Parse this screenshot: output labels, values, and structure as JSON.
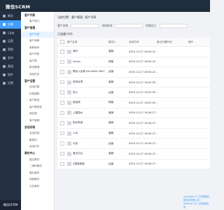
{
  "app": {
    "title": "微信SCRM",
    "bottom_label": "微信SCRM"
  },
  "left_nav": [
    {
      "label": "概况",
      "icon": "home-icon",
      "active": false
    },
    {
      "label": "企微",
      "icon": "wechat-icon",
      "active": true
    },
    {
      "label": "CRM",
      "icon": "crm-icon",
      "active": false
    },
    {
      "label": "运营",
      "icon": "chart-icon",
      "active": false
    },
    {
      "label": "营销",
      "icon": "megaphone-icon",
      "active": false
    },
    {
      "label": "发布",
      "icon": "send-icon",
      "active": false
    },
    {
      "label": "渠道",
      "icon": "channel-icon",
      "active": false
    },
    {
      "label": "插件",
      "icon": "plugin-icon",
      "active": false
    },
    {
      "label": "设置",
      "icon": "gear-icon",
      "active": false
    }
  ],
  "sub_nav": [
    {
      "type": "group",
      "label": "客户列表"
    },
    {
      "type": "item",
      "label": "客户统计"
    },
    {
      "type": "group",
      "label": "客户管理"
    },
    {
      "type": "item",
      "label": "客户列表",
      "active": true
    },
    {
      "type": "item",
      "label": "客户转移"
    },
    {
      "type": "item",
      "label": "离职继承"
    },
    {
      "type": "item",
      "label": "客户标签"
    },
    {
      "type": "item",
      "label": "客户群"
    },
    {
      "type": "item",
      "label": "群发管理"
    },
    {
      "type": "item",
      "label": "添加任务"
    },
    {
      "type": "group",
      "label": "客户运营"
    },
    {
      "type": "item",
      "label": "自动拉群"
    },
    {
      "type": "item",
      "label": "标签建群"
    },
    {
      "type": "item",
      "label": "客户群发"
    },
    {
      "type": "item",
      "label": "客户群群发"
    },
    {
      "type": "item",
      "label": "朋友圈"
    },
    {
      "type": "item",
      "label": "客户营销"
    },
    {
      "type": "group",
      "label": "会话存档"
    },
    {
      "type": "item",
      "label": "会话存档"
    },
    {
      "type": "item",
      "label": "敏感词"
    },
    {
      "type": "item",
      "label": "会话分析"
    },
    {
      "type": "group",
      "label": "素材中心"
    },
    {
      "type": "item",
      "label": "图文素材"
    },
    {
      "type": "item",
      "label": "二维码素材"
    },
    {
      "type": "item",
      "label": "图片素材"
    },
    {
      "type": "item",
      "label": "视频素材"
    },
    {
      "type": "item",
      "label": "文件素材"
    }
  ],
  "breadcrumb": {
    "prefix": "当前位置：",
    "parts": [
      "客户管理",
      "客户列表"
    ]
  },
  "filters": [
    {
      "label": "客户名称",
      "placeholder": ""
    },
    {
      "label": "添加时间",
      "placeholder": ""
    },
    {
      "label": "所属员工",
      "placeholder": ""
    }
  ],
  "section_title": "已选客户(0)",
  "table": {
    "headers": [
      "客户名称",
      "跟进人",
      "添加时间",
      "最近沟通时间",
      "操作"
    ],
    "rows": [
      {
        "name": "海尔",
        "agent": "客服",
        "date": "2019-12-27 16:53:41",
        "last": "-",
        "op": ""
      },
      {
        "name": "Vivian",
        "agent": "顾客",
        "date": "2019-12-27 16:53:41",
        "last": "-",
        "op": ""
      },
      {
        "name": "联系人名称130-4605-4567",
        "agent": "运营",
        "date": "2019-12-27 16:53:41",
        "last": "-",
        "op": ""
      },
      {
        "name": "风的世界",
        "agent": "客服",
        "date": "2019-12-27 16:47:53",
        "last": "-",
        "op": ""
      },
      {
        "name": "悦人",
        "agent": "运营",
        "date": "2019-12-27 16:47:53",
        "last": "-",
        "op": ""
      },
      {
        "name": "段老师",
        "agent": "顾客",
        "date": "2019-12-27 16:47:53",
        "last": "-",
        "op": ""
      },
      {
        "name": "上善若水",
        "agent": "营销",
        "date": "2019-12-27 16:34:27",
        "last": "-",
        "op": ""
      },
      {
        "name": "阳光男孩",
        "agent": "营销",
        "date": "2019-12-27 16:34:27",
        "last": "-",
        "op": ""
      },
      {
        "name": "人水",
        "agent": "客服",
        "date": "2019-12-27 16:34:27",
        "last": "-",
        "op": ""
      },
      {
        "name": "长安",
        "agent": "运营",
        "date": "2019-12-27 16:34:27",
        "last": "-",
        "op": ""
      },
      {
        "name": "蓝天白云",
        "agent": "客服",
        "date": "2019-12-27 16:34:27",
        "last": "-",
        "op": ""
      },
      {
        "name": "A智能家居",
        "agent": "运营",
        "date": "2019-12-27 16:34:27",
        "last": "-",
        "op": ""
      }
    ]
  },
  "footer": "Copyright © 江苏城源网络科技有限公司 | Website: CA 江苏城源网络"
}
